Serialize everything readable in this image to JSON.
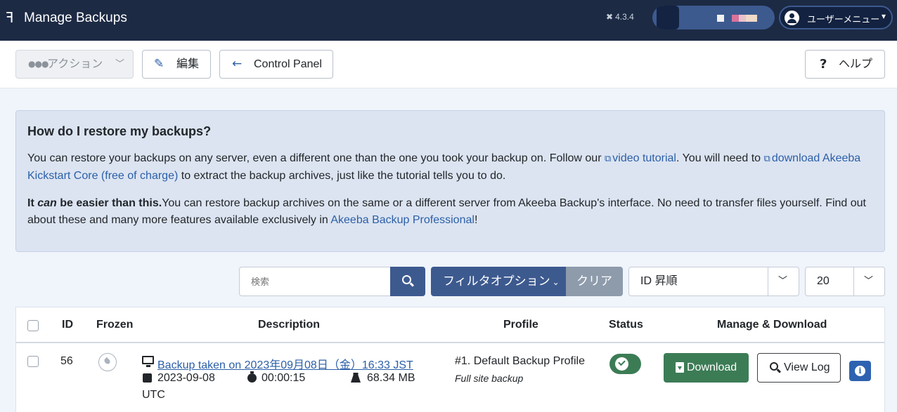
{
  "header": {
    "title": "Manage Backups",
    "version": "4.3.4",
    "user_menu_label": "ユーザーメニュー"
  },
  "toolbar": {
    "actions_label": "アクション",
    "edit_label": "編集",
    "control_panel_label": "Control Panel",
    "help_label": "ヘルプ"
  },
  "info": {
    "heading": "How do I restore my backups?",
    "p1_text_a": "You can restore your backups on any server, even a different one than the one you took your backup on. Follow our ",
    "p1_link1": "video tutorial",
    "p1_text_b": ". You will need to ",
    "p1_link2": "download Akeeba Kickstart Core (free of charge)",
    "p1_text_c": " to extract the backup archives, just like the tutorial tells you to do.",
    "p2_bold_a": "It ",
    "p2_bold_em": "can",
    "p2_bold_b": " be easier than this.",
    "p2_text_a": "You can restore backup archives on the same or a different server from Akeeba Backup's interface. No need to transfer files yourself. Find out about these and many more features available exclusively in ",
    "p2_link": "Akeeba Backup Professional",
    "p2_text_b": "!"
  },
  "filters": {
    "search_placeholder": "検索",
    "filter_options_label": "フィルタオプション",
    "clear_label": "クリア",
    "sort_value": "ID 昇順",
    "limit_value": "20"
  },
  "table": {
    "columns": {
      "id": "ID",
      "frozen": "Frozen",
      "description": "Description",
      "profile": "Profile",
      "status": "Status",
      "manage": "Manage & Download"
    },
    "rows": [
      {
        "id": "56",
        "description": "Backup taken on 2023年09月08日（金）16:33 JST",
        "date": "2023-09-08",
        "timezone": "UTC",
        "duration": "00:00:15",
        "size": "68.34 MB",
        "profile": "#1. Default Backup Profile",
        "backup_type": "Full site backup",
        "download_label": "Download",
        "view_log_label": "View Log"
      }
    ]
  },
  "colors": {
    "header_bg": "#1c2a44",
    "primary": "#3d5a8f",
    "success": "#3c7c55",
    "link": "#2b5fa8"
  }
}
